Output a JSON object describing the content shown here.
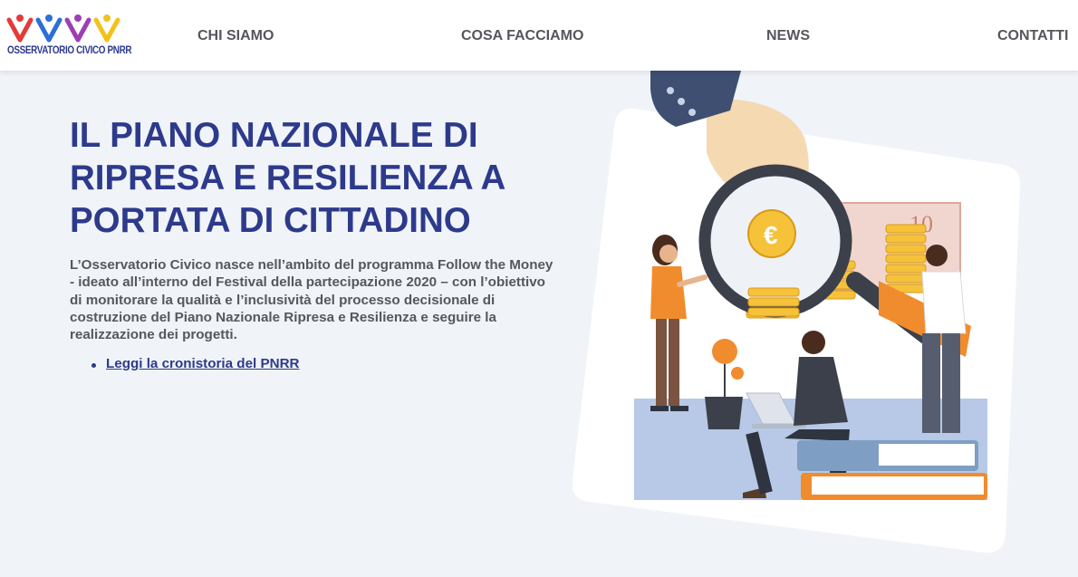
{
  "brand": {
    "logo_text": "OSSERVATORIO CIVICO PNRR"
  },
  "nav": {
    "items": [
      {
        "label": "CHI SIAMO"
      },
      {
        "label": "COSA FACCIAMO"
      },
      {
        "label": "NEWS"
      },
      {
        "label": "CONTATTI"
      }
    ]
  },
  "hero": {
    "title_lines": [
      "IL PIANO NAZIONALE DI",
      "RIPRESA E RESILIENZA A",
      "PORTATA DI CITTADINO"
    ],
    "description": "L’Osservatorio Civico nasce nell’ambito del programma Follow the Money - ideato all’interno del Festival della partecipazione 2020 – con l’obiettivo di monitorare la qualità e l’inclusività del processo decisionale di costruzione del Piano Nazionale Ripresa e Resilienza e seguire la realizzazione dei progetti.",
    "links": [
      {
        "label": "Leggi la cronistoria del PNRR"
      }
    ]
  },
  "illustration": {
    "banknote_value": "10",
    "coin_symbol": "€"
  },
  "colors": {
    "brand_blue": "#2d3a8c",
    "nav_text": "#55575c",
    "accent_orange": "#f08c2e",
    "background": "#f0f4f8"
  }
}
